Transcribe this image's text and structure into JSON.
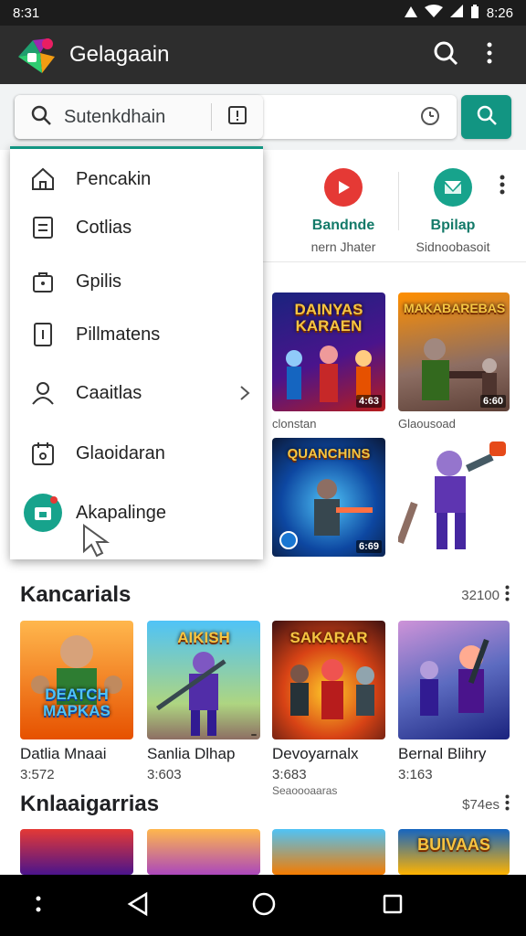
{
  "status_bar": {
    "time_left": "8:31",
    "time_right": "8:26"
  },
  "app_bar": {
    "title": "Gelagaain",
    "icons": [
      "app-logo",
      "search-icon",
      "more-vert-icon"
    ]
  },
  "search": {
    "chip_text": "Sutenkdhain",
    "icons": [
      "search-icon",
      "alert-box-icon",
      "clock-icon",
      "search-icon"
    ],
    "accent": "#129582"
  },
  "app_strip": {
    "items": [
      {
        "title": "Bandnde",
        "subtitle": "nern Jhater",
        "icon": "play-icon",
        "color": "#e53935"
      },
      {
        "title": "Bpilap",
        "subtitle": "Sidnoobasoit",
        "icon": "mail-icon",
        "color": "#17a38c"
      }
    ]
  },
  "menu": {
    "items": [
      {
        "label": "Pencakin",
        "icon": "home-icon"
      },
      {
        "label": "Cotlias",
        "icon": "document-icon"
      },
      {
        "label": "Gpilis",
        "icon": "bag-icon"
      },
      {
        "label": "Pillmatens",
        "icon": "phone-icon"
      },
      {
        "label": "Caaitlas",
        "icon": "person-icon"
      },
      {
        "label": "Glaoidaran",
        "icon": "calendar-icon"
      },
      {
        "label": "Akapalinge",
        "icon": "green-app-icon"
      }
    ]
  },
  "top_grid": [
    {
      "caption": "DAINYAS KARAEN",
      "badge": "4:63",
      "label": "clonstan"
    },
    {
      "caption": "MAKABAREBAS",
      "badge": "6:60",
      "label": "Glaousoad"
    },
    {
      "caption": "QUANCHINS",
      "badge": "6:69",
      "label": ""
    },
    {
      "caption": "",
      "badge": "",
      "label": ""
    }
  ],
  "sections": [
    {
      "title": "Kancarials",
      "count": "32100",
      "cards": [
        {
          "caption": "DEATCH MAPKAS",
          "badge": "",
          "title": "Datlia Mnaai",
          "meta": "3:572",
          "sub": ""
        },
        {
          "caption": "AIKISH",
          "badge": "",
          "title": "Sanlia Dlhap",
          "meta": "3:603",
          "sub": ""
        },
        {
          "caption": "SAKARAR",
          "badge": "",
          "title": "Devoyarnalx",
          "meta": "3:683",
          "sub": "Seaoooaaras"
        },
        {
          "caption": "",
          "badge": "",
          "title": "Bernal Blihry",
          "meta": "3:163",
          "sub": ""
        }
      ]
    },
    {
      "title": "Knlaaigarrias",
      "count": "$74es",
      "cards": [
        {
          "caption": "",
          "badge": ""
        },
        {
          "caption": "",
          "badge": ""
        },
        {
          "caption": "",
          "badge": ""
        },
        {
          "caption": "BUIVAAS",
          "badge": ""
        }
      ]
    }
  ]
}
